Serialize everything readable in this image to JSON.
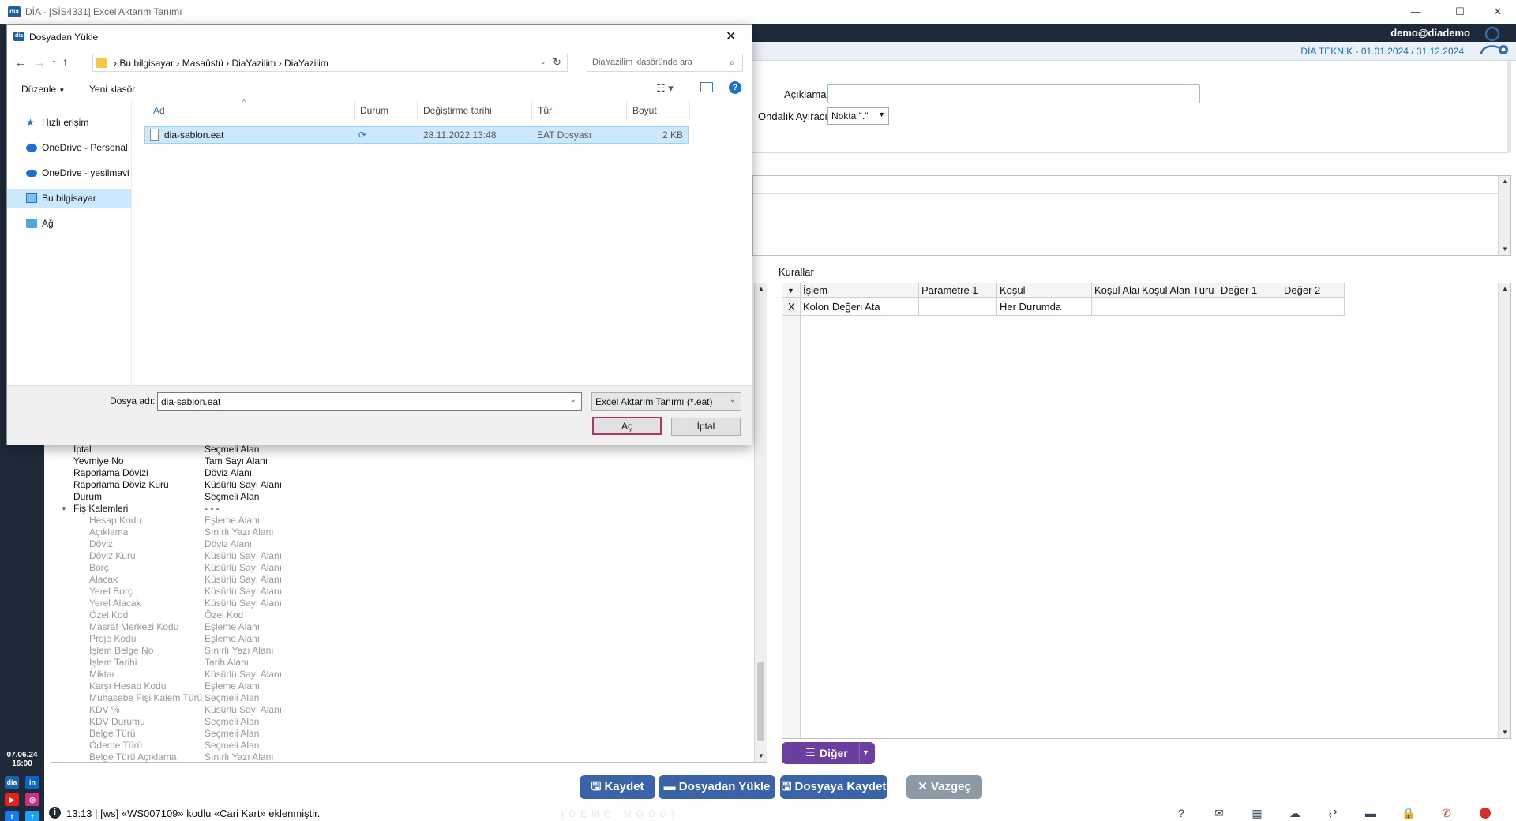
{
  "window": {
    "title": "DİA - [SİS4331] Excel Aktarım Tanımı",
    "controls": {
      "minimize": "—",
      "maximize": "☐",
      "close": "✕"
    }
  },
  "header": {
    "user": "demo@diademo",
    "period": "DİA TEKNİK -  01.01.2024 / 31.12.2024"
  },
  "sidebar": {
    "date": "07.06.24",
    "time": "16:00",
    "social": [
      "dia",
      "in",
      "▶",
      "◎",
      "f",
      "t"
    ]
  },
  "form": {
    "aciklama_label": "Açıklama",
    "aciklama_value": "",
    "ondalik_label": "Ondalık Ayıracı",
    "ondalik_value": "Nokta \".\""
  },
  "rules": {
    "label": "Kurallar",
    "columns": [
      "İşlem",
      "Parametre 1",
      "Koşul",
      "Koşul Alan",
      "Koşul Alan Türü",
      "Değer 1",
      "Değer 2"
    ],
    "rows": [
      {
        "marker": "X",
        "islem": "Kolon Değeri Ata",
        "param1": "",
        "kosul": "Her Durumda",
        "kosul_alan": "",
        "kosul_alan_turu": "",
        "deger1": "",
        "deger2": ""
      }
    ],
    "other_button": "Diğer"
  },
  "tree": {
    "top_items": [
      {
        "name": "İptal",
        "type": "Seçmeli Alan"
      },
      {
        "name": "Yevmiye No",
        "type": "Tam Sayı Alanı"
      },
      {
        "name": "Raporlama Dövizi",
        "type": "Döviz Alanı"
      },
      {
        "name": "Raporlama Döviz Kuru",
        "type": "Küsürlü Sayı Alanı"
      },
      {
        "name": "Durum",
        "type": "Seçmeli Alan"
      }
    ],
    "group": {
      "name": "Fiş Kalemleri",
      "type": "- - -"
    },
    "children": [
      {
        "name": "Hesap Kodu",
        "type": "Eşleme Alanı"
      },
      {
        "name": "Açıklama",
        "type": "Sınırlı Yazı Alanı"
      },
      {
        "name": "Döviz",
        "type": "Döviz Alanı"
      },
      {
        "name": "Döviz Kuru",
        "type": "Küsürlü Sayı Alanı"
      },
      {
        "name": "Borç",
        "type": "Küsürlü Sayı Alanı"
      },
      {
        "name": "Alacak",
        "type": "Küsürlü Sayı Alanı"
      },
      {
        "name": "Yerel Borç",
        "type": "Küsürlü Sayı Alanı"
      },
      {
        "name": "Yerel Alacak",
        "type": "Küsürlü Sayı Alanı"
      },
      {
        "name": "Özel Kod",
        "type": "Özel Kod"
      },
      {
        "name": "Masraf Merkezi Kodu",
        "type": "Eşleme Alanı"
      },
      {
        "name": "Proje Kodu",
        "type": "Eşleme Alanı"
      },
      {
        "name": "İşlem Belge No",
        "type": "Sınırlı Yazı Alanı"
      },
      {
        "name": "İşlem Tarihi",
        "type": "Tarih Alanı"
      },
      {
        "name": "Miktar",
        "type": "Küsürlü Sayı Alanı"
      },
      {
        "name": "Karşı Hesap Kodu",
        "type": "Eşleme Alanı"
      },
      {
        "name": "Muhasebe Fişi Kalem Türü",
        "type": "Seçmeli Alan"
      },
      {
        "name": "KDV %",
        "type": "Küsürlü Sayı Alanı"
      },
      {
        "name": "KDV Durumu",
        "type": "Seçmeli Alan"
      },
      {
        "name": "Belge Türü",
        "type": "Seçmeli Alan"
      },
      {
        "name": "Ödeme Türü",
        "type": "Seçmeli Alan"
      },
      {
        "name": "Belge Türü Açıklama",
        "type": "Sınırlı Yazı Alanı"
      }
    ]
  },
  "buttons": {
    "kaydet": "Kaydet",
    "dosyadan_yukle": "Dosyadan Yükle",
    "dosyaya_kaydet": "Dosyaya Kaydet",
    "vazgec": "Vazgeç"
  },
  "status": {
    "message": "13:13  |  [ws] «WS007109» kodlu «Cari Kart» eklenmiştir.",
    "watermark": "[DEMO MODU]"
  },
  "dialog": {
    "title": "Dosyadan Yükle",
    "breadcrumb": [
      "Bu bilgisayar",
      "Masaüstü",
      "DiaYazilim",
      "DiaYazilim"
    ],
    "search_placeholder": "DiaYazilim klasöründe ara",
    "toolbar": {
      "organize": "Düzenle",
      "new_folder": "Yeni klasör"
    },
    "nav": [
      "Hızlı erişim",
      "OneDrive - Personal",
      "OneDrive - yesilmavi",
      "Bu bilgisayar",
      "Ağ"
    ],
    "columns": [
      "Ad",
      "Durum",
      "Değiştirme tarihi",
      "Tür",
      "Boyut"
    ],
    "file": {
      "name": "dia-sablon.eat",
      "date": "28.11.2022 13:48",
      "type": "EAT Dosyası",
      "size": "2 KB"
    },
    "filename_label": "Dosya adı:",
    "filename_value": "dia-sablon.eat",
    "filter": "Excel Aktarım Tanımı (*.eat)",
    "open_button": "Aç",
    "cancel_button": "İptal"
  },
  "colors": {
    "sidebar": "#1e2a3a",
    "accent_blue": "#3a63a8",
    "diger_purple": "#6b3fa0",
    "selection": "#cce8ff",
    "open_highlight": "#b0336e"
  }
}
